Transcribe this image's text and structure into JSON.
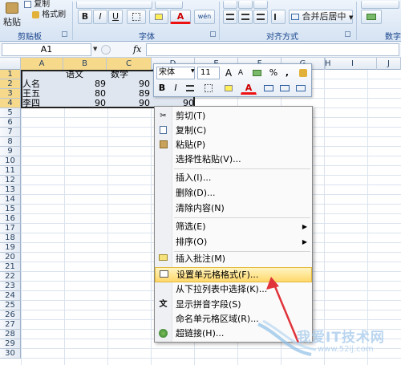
{
  "ribbon": {
    "paste_label": "粘贴",
    "copy_label": "复制",
    "format_painter_label": "格式刷",
    "group_clipboard": "剪贴板",
    "group_font": "字体",
    "group_alignment": "对齐方式",
    "group_number": "数字",
    "merge_label": "合并后居中",
    "font_buttons": [
      "B",
      "I",
      "U"
    ],
    "font_color_glyph": "A",
    "phonetic_glyph": "wén"
  },
  "formula_bar": {
    "name_box": "A1",
    "fx_label": "fx"
  },
  "columns": [
    "A",
    "B",
    "C",
    "D",
    "E",
    "F",
    "G",
    "H",
    "I",
    "J"
  ],
  "rows": [
    "1",
    "2",
    "3",
    "4",
    "5",
    "6",
    "7",
    "8",
    "9",
    "10",
    "11",
    "12",
    "13",
    "14",
    "15",
    "16",
    "17",
    "18",
    "19",
    "20",
    "21",
    "22",
    "23",
    "24",
    "25",
    "26",
    "27",
    "28",
    "29",
    "30"
  ],
  "cells": {
    "b1": "语文",
    "c1": "数学",
    "a2": "人名",
    "b2": "89",
    "c2": "90",
    "a3": "王五",
    "b3": "80",
    "c3": "89",
    "a4": "李四",
    "b4": "90",
    "c4": "90",
    "d4": "90"
  },
  "mini_toolbar": {
    "font_name": "宋体",
    "font_size": "11",
    "grow_font": "A",
    "shrink_font": "A",
    "percent": "%",
    "comma": ",",
    "bold": "B",
    "italic": "I",
    "font_color": "A"
  },
  "context_menu": {
    "items": [
      "剪切(T)",
      "复制(C)",
      "粘贴(P)",
      "选择性粘贴(V)...",
      "插入(I)...",
      "删除(D)...",
      "清除内容(N)",
      "筛选(E)",
      "排序(O)",
      "插入批注(M)",
      "设置单元格格式(F)...",
      "从下拉列表中选择(K)...",
      "显示拼音字段(S)",
      "命名单元格区域(R)...",
      "超链接(H)..."
    ],
    "highlight_color": "#ffd86b"
  },
  "watermark": {
    "text": "我爱IT技术网",
    "url": "www.52ij.com"
  },
  "colors": {
    "ribbon_text": "#15428b",
    "arrow": "#e0333a",
    "selection_fill": "#dfe6f0"
  }
}
